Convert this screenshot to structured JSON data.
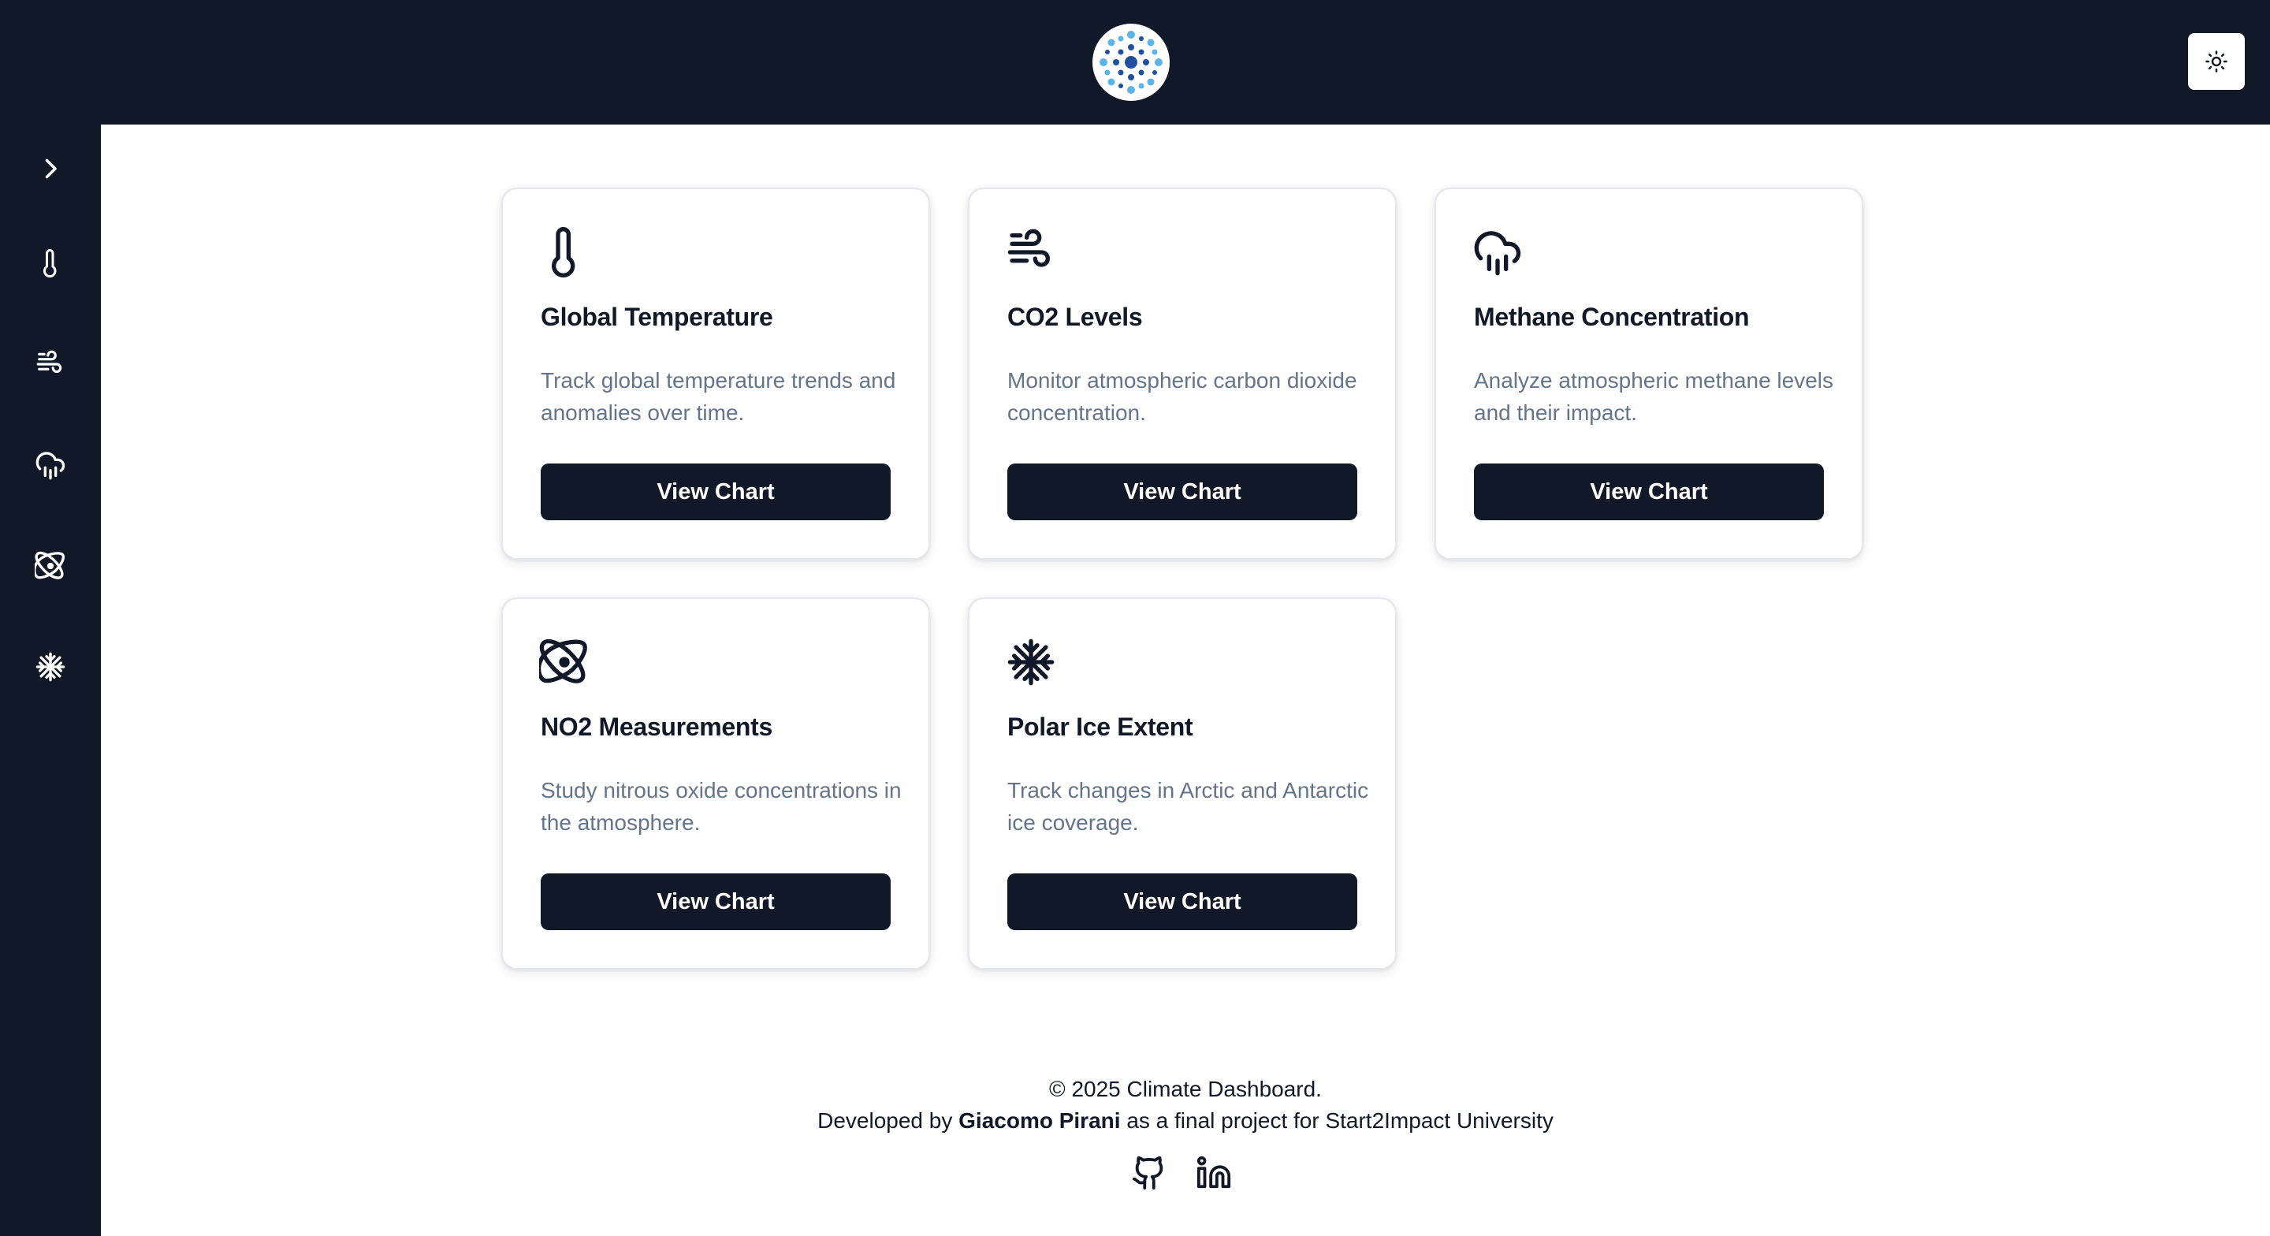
{
  "header": {
    "logo_icon": "climate-logo-icon",
    "theme_toggle_icon": "sun-icon"
  },
  "sidebar": {
    "items": [
      {
        "icon": "chevron-right-icon",
        "name": "expand"
      },
      {
        "icon": "thermometer-icon",
        "name": "temperature"
      },
      {
        "icon": "wind-icon",
        "name": "co2"
      },
      {
        "icon": "cloud-rain-icon",
        "name": "methane"
      },
      {
        "icon": "atom-icon",
        "name": "no2"
      },
      {
        "icon": "snowflake-icon",
        "name": "polar-ice"
      }
    ]
  },
  "cards": [
    {
      "icon": "thermometer-icon",
      "title": "Global Temperature",
      "description": "Track global temperature trends and anomalies over time.",
      "button": "View Chart"
    },
    {
      "icon": "wind-icon",
      "title": "CO2 Levels",
      "description": "Monitor atmospheric carbon dioxide concentration.",
      "button": "View Chart"
    },
    {
      "icon": "cloud-rain-icon",
      "title": "Methane Concentration",
      "description": "Analyze atmospheric methane levels and their impact.",
      "button": "View Chart"
    },
    {
      "icon": "atom-icon",
      "title": "NO2 Measurements",
      "description": "Study nitrous oxide concentrations in the atmosphere.",
      "button": "View Chart"
    },
    {
      "icon": "snowflake-icon",
      "title": "Polar Ice Extent",
      "description": "Track changes in Arctic and Antarctic ice coverage.",
      "button": "View Chart"
    }
  ],
  "footer": {
    "copyright": "© 2025 Climate Dashboard.",
    "developed_prefix": "Developed by",
    "author": "Giacomo Pirani",
    "developed_suffix": "as a final project for Start2Impact University",
    "links": [
      {
        "icon": "github-icon"
      },
      {
        "icon": "linkedin-icon"
      }
    ]
  },
  "colors": {
    "navy": "#111827",
    "muted_text": "#64748b",
    "card_border": "#e5e7eb",
    "logo_blue_light": "#5ab4e6",
    "logo_blue_dark": "#1e4fa3"
  }
}
